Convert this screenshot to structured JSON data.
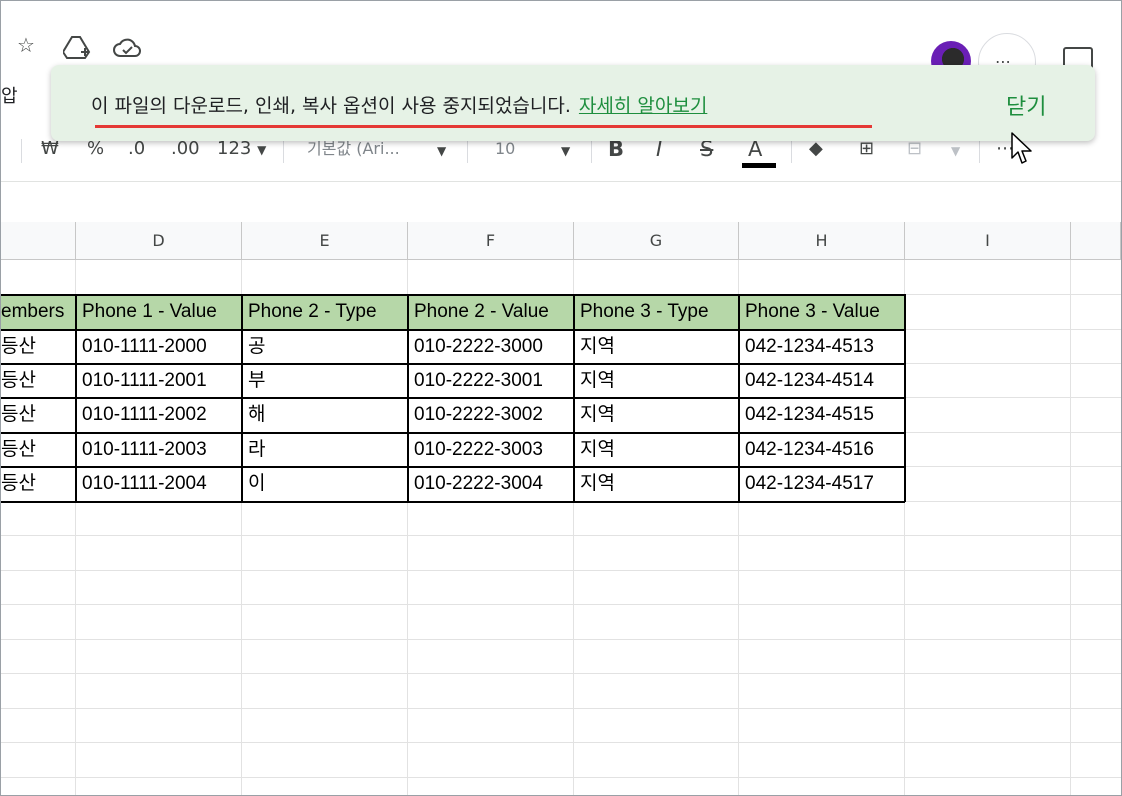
{
  "menu": {
    "fragment": "압"
  },
  "toolbar": {
    "currency": "₩",
    "percent": "%",
    "decrease_decimals": ".0",
    "increase_decimals": ".00",
    "number_format": "123",
    "font": "기본값 (Ari...",
    "font_size": "10",
    "bold": "B",
    "italic": "I",
    "strikethrough": "S",
    "text_color": "A",
    "more": "⋯"
  },
  "toast": {
    "message": "이 파일의 다운로드, 인쇄, 복사 옵션이 사용 중지되었습니다.",
    "link": "자세히 알아보기",
    "close": "닫기"
  },
  "grid": {
    "columns": [
      "D",
      "E",
      "F",
      "G",
      "H",
      "I"
    ],
    "header_row": [
      "embers",
      "Phone 1 - Value",
      "Phone 2 - Type",
      "Phone 2 - Value",
      "Phone 3 - Type",
      "Phone 3 - Value"
    ],
    "rows": [
      [
        "등산",
        "010-1111-2000",
        "공",
        "010-2222-3000",
        "지역",
        "042-1234-4513"
      ],
      [
        "등산",
        "010-1111-2001",
        "부",
        "010-2222-3001",
        "지역",
        "042-1234-4514"
      ],
      [
        "등산",
        "010-1111-2002",
        "해",
        "010-2222-3002",
        "지역",
        "042-1234-4515"
      ],
      [
        "등산",
        "010-1111-2003",
        "라",
        "010-2222-3003",
        "지역",
        "042-1234-4516"
      ],
      [
        "등산",
        "010-1111-2004",
        "이",
        "010-2222-3004",
        "지역",
        "042-1234-4517"
      ]
    ]
  },
  "colors": {
    "header_fill": "#b6d7a8",
    "toast_bg": "#e6f2e6",
    "link": "#1e8e3e",
    "underline_mark": "#e53935"
  }
}
